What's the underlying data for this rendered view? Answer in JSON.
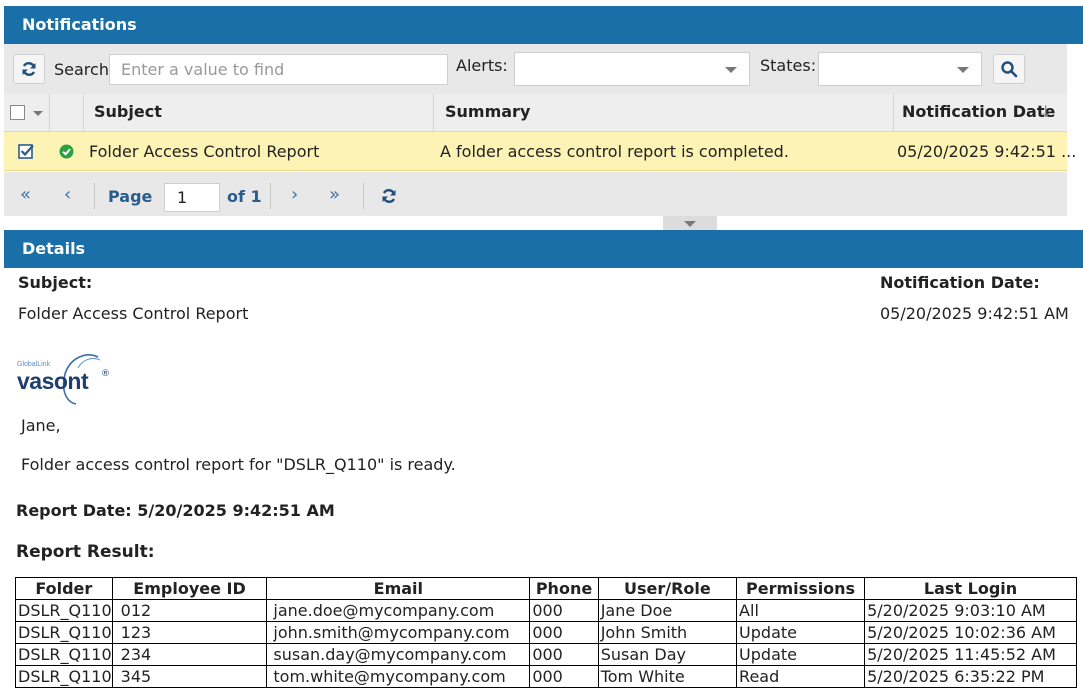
{
  "notifications": {
    "title": "Notifications",
    "toolbar": {
      "search_label": "Search:",
      "search_placeholder": "Enter a value to find",
      "alerts_label": "Alerts:",
      "states_label": "States:"
    },
    "columns": {
      "subject": "Subject",
      "summary": "Summary",
      "notification_date": "Notification Date",
      "sort_indicator": "↓"
    },
    "rows": [
      {
        "selected": true,
        "status": "completed",
        "subject": "Folder Access Control Report",
        "summary": "A folder access control report is completed.",
        "date": "05/20/2025 9:42:51 ..."
      }
    ],
    "pager": {
      "page_label": "Page",
      "page_value": "1",
      "of_label": "of 1"
    }
  },
  "details": {
    "title": "Details",
    "subject_label": "Subject:",
    "subject_value": "Folder Access Control Report",
    "date_label": "Notification Date:",
    "date_value": "05/20/2025 9:42:51 AM",
    "logo_small": "GlobalLink",
    "logo_main": "vasont",
    "greeting": "Jane,",
    "message": "Folder access control report for \"DSLR_Q110\" is ready.",
    "report_date": "Report Date: 5/20/2025 9:42:51 AM",
    "report_result": "Report Result:",
    "report": {
      "headers": [
        "Folder",
        "Employee ID",
        "Email",
        "Phone",
        "User/Role",
        "Permissions",
        "Last Login"
      ],
      "rows": [
        [
          "DSLR_Q110",
          "012",
          "jane.doe@mycompany.com",
          "000",
          "Jane Doe",
          "All",
          "5/20/2025 9:03:10 AM"
        ],
        [
          "DSLR_Q110",
          "123",
          "john.smith@mycompany.com",
          "000",
          "John Smith",
          "Update",
          "5/20/2025 10:02:36 AM"
        ],
        [
          "DSLR_Q110",
          "234",
          "susan.day@mycompany.com",
          "000",
          "Susan Day",
          "Update",
          "5/20/2025 11:45:52 AM"
        ],
        [
          "DSLR_Q110",
          "345",
          "tom.white@mycompany.com",
          "000",
          "Tom White",
          "Read",
          "5/20/2025 6:35:22 PM"
        ]
      ]
    }
  },
  "colors": {
    "header_blue": "#1b6fa8",
    "selected_row": "#fdf3b4",
    "status_green": "#2ea043",
    "pager_blue": "#3a73a6"
  }
}
